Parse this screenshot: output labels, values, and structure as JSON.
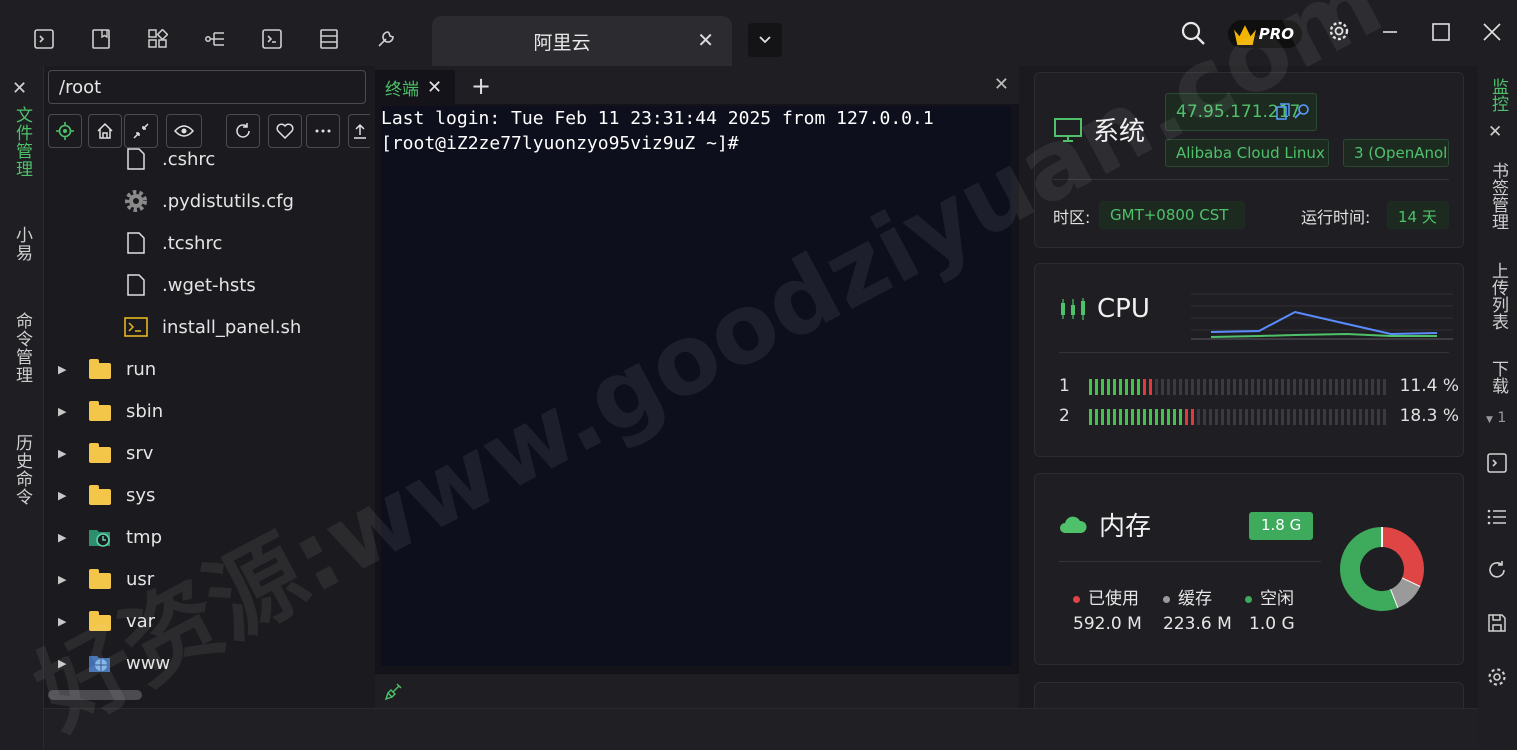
{
  "titlebar": {
    "tab_title": "阿里云",
    "left_icons": [
      "terminal-icon",
      "bookmark-icon",
      "grid-icon",
      "tree-icon",
      "terminal-icon",
      "list-icon",
      "wrench-icon"
    ],
    "pro_label": "PRO"
  },
  "leftrail": {
    "items": [
      {
        "label": "文件管理",
        "active": true
      },
      {
        "label": "小易",
        "active": false
      },
      {
        "label": "命令管理",
        "active": false
      },
      {
        "label": "历史命令",
        "active": false
      }
    ]
  },
  "filepanel": {
    "path": "/root",
    "files": [
      {
        "name": ".cshrc",
        "icon": "file-icon",
        "expandable": false
      },
      {
        "name": ".pydistutils.cfg",
        "icon": "gear-icon",
        "expandable": false
      },
      {
        "name": ".tcshrc",
        "icon": "file-icon",
        "expandable": false
      },
      {
        "name": ".wget-hsts",
        "icon": "file-icon",
        "expandable": false
      },
      {
        "name": "install_panel.sh",
        "icon": "shell-script-icon",
        "expandable": false
      },
      {
        "name": "run",
        "icon": "folder-icon",
        "expandable": true
      },
      {
        "name": "sbin",
        "icon": "folder-icon",
        "expandable": true
      },
      {
        "name": "srv",
        "icon": "folder-icon",
        "expandable": true
      },
      {
        "name": "sys",
        "icon": "folder-icon",
        "expandable": true
      },
      {
        "name": "tmp",
        "icon": "folder-clock-icon",
        "expandable": true
      },
      {
        "name": "usr",
        "icon": "folder-icon",
        "expandable": true
      },
      {
        "name": "var",
        "icon": "folder-icon",
        "expandable": true
      },
      {
        "name": "www",
        "icon": "folder-globe-icon",
        "expandable": true
      }
    ]
  },
  "terminal": {
    "tab_label": "终端",
    "lines": [
      "Last login: Tue Feb 11 23:31:44 2025 from 127.0.0.1",
      "[root@iZ2ze77lyuonzyo95viz9uZ ~]#"
    ]
  },
  "monitor": {
    "system": {
      "title": "系统",
      "ip": "47.95.171.217",
      "os": "Alibaba Cloud Linux",
      "os_version": "3 (OpenAnoli",
      "timezone_label": "时区:",
      "timezone_value": "GMT+0800  CST",
      "uptime_label": "运行时间:",
      "uptime_value": "14 天"
    },
    "cpu": {
      "title": "CPU",
      "cores": [
        {
          "index": "1",
          "percent_label": "11.4 %",
          "percent": 11.4
        },
        {
          "index": "2",
          "percent_label": "18.3 %",
          "percent": 18.3
        }
      ]
    },
    "memory": {
      "title": "内存",
      "total_badge": "1.8 G",
      "legend": [
        {
          "label": "已使用",
          "value": "592.0 M",
          "color": "#e04545"
        },
        {
          "label": "缓存",
          "value": "223.6 M",
          "color": "#9a9a9a"
        },
        {
          "label": "空闲",
          "value": "1.0 G",
          "color": "#3daa5c"
        }
      ],
      "donut_fractions": [
        0.32,
        0.12,
        0.56
      ]
    }
  },
  "rightrail": {
    "items": [
      {
        "label": "监控",
        "active": true
      },
      {
        "label": "书签管理",
        "active": false
      },
      {
        "label": "上传列表",
        "active": false
      },
      {
        "label": "下载",
        "active": false
      }
    ],
    "download_count": "1"
  },
  "colors": {
    "accent": "#4fc16b",
    "background": "#1b1b1f",
    "terminal_bg": "#0d0f1c"
  },
  "watermark": "好资源:www.goodziyuan.com"
}
